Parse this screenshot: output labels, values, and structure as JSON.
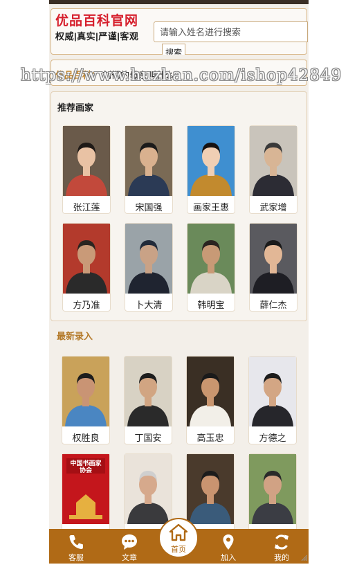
{
  "header": {
    "logo_title": "优品百科官网",
    "logo_subtitle": "权威|真实|严谨|客观",
    "search_placeholder": "请输入姓名进行搜索",
    "search_button": "搜索"
  },
  "notice": {
    "label": "优品百科：",
    "text": "刘彻的母亲叫什么"
  },
  "watermark": "https://www.huzhan.com/ishop42849",
  "recommended": {
    "title": "推荐画家",
    "artists": [
      {
        "name": "张江莲",
        "bg": "#6a5a4a",
        "shirt": "#c2493b",
        "skin": "#e9c2a4",
        "hair": "#1f1a17"
      },
      {
        "name": "宋国强",
        "bg": "#7a6a55",
        "shirt": "#2b3a55",
        "skin": "#d9b18f",
        "hair": "#1b1b1b"
      },
      {
        "name": "画家王惠",
        "bg": "#3f8fd0",
        "shirt": "#c28a2e",
        "skin": "#f0cfb4",
        "hair": "#161212"
      },
      {
        "name": "武家增",
        "bg": "#c9c4bb",
        "shirt": "#2c2c34",
        "skin": "#d8b595",
        "hair": "#3a3a3a"
      },
      {
        "name": "方乃准",
        "bg": "#b33a2c",
        "shirt": "#2a2a2a",
        "skin": "#c99a78",
        "hair": "#2a2520"
      },
      {
        "name": "卜大清",
        "bg": "#9aa3a8",
        "shirt": "#1f2430",
        "skin": "#c9a286",
        "hair": "#222b3a"
      },
      {
        "name": "韩明宝",
        "bg": "#6a8a5a",
        "shirt": "#d9d4c6",
        "skin": "#c89a76",
        "hair": "#2a2420"
      },
      {
        "name": "薛仁杰",
        "bg": "#5a5a5f",
        "shirt": "#1e1e24",
        "skin": "#e2b796",
        "hair": "#1a1a1a"
      }
    ]
  },
  "latest": {
    "title": "最新录入",
    "artists": [
      {
        "name": "权胜良",
        "bg": "#c9a25a",
        "shirt": "#4a86c2",
        "skin": "#c99474",
        "hair": "#1d1d1d"
      },
      {
        "name": "丁国安",
        "bg": "#d8d2c4",
        "shirt": "#2a2a2a",
        "skin": "#d1a582",
        "hair": "#1d1d1d"
      },
      {
        "name": "高玉忠",
        "bg": "#3a2f24",
        "shirt": "#f2efe8",
        "skin": "#c9966f",
        "hair": "#1a1a1a"
      },
      {
        "name": "方德之",
        "bg": "#e7e7ec",
        "shirt": "#26262b",
        "skin": "#d3a684",
        "hair": "#1c1c1c"
      },
      {
        "name": "",
        "bg": "#c4161c",
        "shirt": "#c4161c",
        "skin": "#c4161c",
        "hair": "#c4161c"
      },
      {
        "name": "",
        "bg": "#eae3da",
        "shirt": "#3a3a3d",
        "skin": "#d6a98c",
        "hair": "#cfcfcf"
      },
      {
        "name": "",
        "bg": "#4a3a2c",
        "shirt": "#3a5b7a",
        "skin": "#c99470",
        "hair": "#1c1c1c"
      },
      {
        "name": "",
        "bg": "#7f9a5e",
        "shirt": "#3b3d44",
        "skin": "#d1a284",
        "hair": "#2a2a2a"
      }
    ],
    "poster_text": "中国书画家协会"
  },
  "nav": {
    "items": [
      {
        "label": "客服",
        "icon": "phone-icon"
      },
      {
        "label": "文章",
        "icon": "chat-bubble-icon"
      },
      {
        "label": "首页",
        "icon": "home-icon"
      },
      {
        "label": "加入",
        "icon": "location-pin-icon"
      },
      {
        "label": "我的",
        "icon": "refresh-icon"
      }
    ]
  },
  "colors": {
    "accent": "#b06a16",
    "brand_red": "#d61f2c",
    "gold_text": "#b47a2a"
  }
}
